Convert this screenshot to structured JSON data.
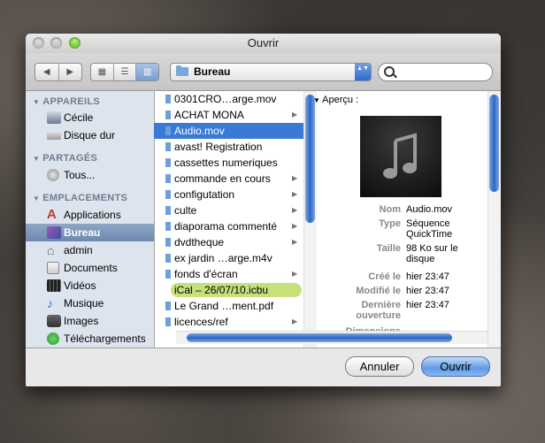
{
  "window": {
    "title": "Ouvrir"
  },
  "toolbar": {
    "nav_back": "◀",
    "nav_forward": "▶",
    "view_icons": "▦",
    "view_list": "☰",
    "view_columns": "▥",
    "location": "Bureau",
    "popup_arrows": "▲▼"
  },
  "sidebar": {
    "sections": [
      {
        "title": "APPAREILS",
        "items": [
          {
            "label": "Cécile",
            "icon": "computer-icon"
          },
          {
            "label": "Disque dur",
            "icon": "hard-drive-icon"
          }
        ]
      },
      {
        "title": "PARTAGÉS",
        "items": [
          {
            "label": "Tous...",
            "icon": "network-icon"
          }
        ]
      },
      {
        "title": "EMPLACEMENTS",
        "items": [
          {
            "label": "Applications",
            "icon": "applications-icon"
          },
          {
            "label": "Bureau",
            "icon": "desktop-icon"
          },
          {
            "label": "admin",
            "icon": "home-icon"
          },
          {
            "label": "Documents",
            "icon": "documents-icon"
          },
          {
            "label": "Vidéos",
            "icon": "movies-icon"
          },
          {
            "label": "Musique",
            "icon": "music-icon"
          },
          {
            "label": "Images",
            "icon": "pictures-icon"
          },
          {
            "label": "Téléchargements",
            "icon": "downloads-icon"
          }
        ]
      }
    ],
    "selected": "Bureau"
  },
  "files": [
    {
      "name": "0301CRO…arge.mov",
      "folder": false
    },
    {
      "name": "ACHAT MONA",
      "folder": true
    },
    {
      "name": "Audio.mov",
      "folder": false,
      "selected": true
    },
    {
      "name": "avast! Registration",
      "folder": false
    },
    {
      "name": "cassettes numeriques",
      "folder": false
    },
    {
      "name": "commande en cours",
      "folder": true
    },
    {
      "name": "configutation",
      "folder": true
    },
    {
      "name": "culte",
      "folder": true
    },
    {
      "name": "diaporama commenté",
      "folder": true
    },
    {
      "name": "dvdtheque",
      "folder": true
    },
    {
      "name": "ex jardin …arge.m4v",
      "folder": false
    },
    {
      "name": "fonds d'écran",
      "folder": true
    },
    {
      "name": "iCal – 26/07/10.icbu",
      "folder": false,
      "label": "green"
    },
    {
      "name": "Le Grand …ment.pdf",
      "folder": false
    },
    {
      "name": "licences/ref",
      "folder": true
    }
  ],
  "preview": {
    "header": "Aperçu :",
    "fields": [
      {
        "key": "Nom",
        "value": "Audio.mov"
      },
      {
        "key": "Type",
        "value": "Séquence QuickTime"
      },
      {
        "key": "Taille",
        "value": "98 Ko sur le disque"
      },
      {
        "key": "Créé le",
        "value": "hier 23:47"
      },
      {
        "key": "Modifié le",
        "value": "hier 23:47"
      },
      {
        "key": "Dernière ouverture",
        "value": "hier 23:47"
      },
      {
        "key": "Dimensions",
        "value": "--"
      }
    ]
  },
  "buttons": {
    "cancel": "Annuler",
    "open": "Ouvrir"
  }
}
